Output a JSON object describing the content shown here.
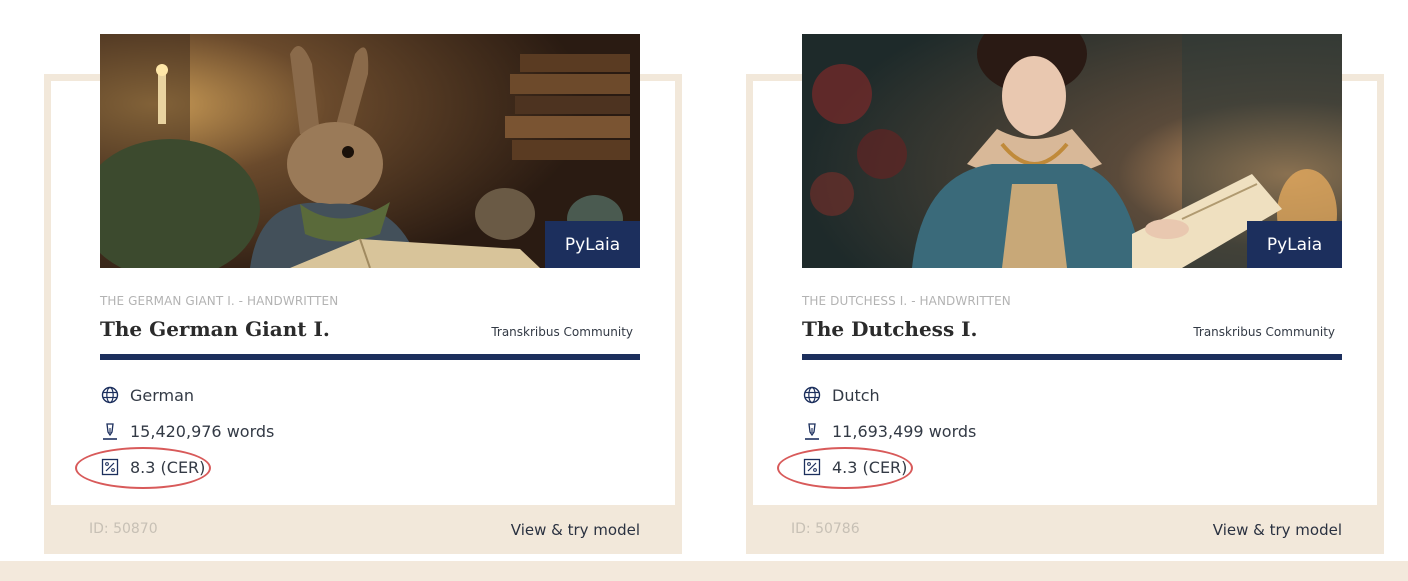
{
  "cards": [
    {
      "badge": "PyLaia",
      "subtitle": "THE GERMAN GIANT I. - HANDWRITTEN",
      "title": "The German Giant I.",
      "owner": "Transkribus Community",
      "language": "German",
      "words": "15,420,976 words",
      "cer": "8.3 (CER)",
      "id": "ID: 50870",
      "link": "View & try model",
      "image": "rabbit-reading-book-illustration"
    },
    {
      "badge": "PyLaia",
      "subtitle": "THE DUTCHESS I. - HANDWRITTEN",
      "title": "The Dutchess I.",
      "owner": "Transkribus Community",
      "language": "Dutch",
      "words": "11,693,499 words",
      "cer": "4.3 (CER)",
      "id": "ID: 50786",
      "link": "View & try model",
      "image": "lady-reading-book-illustration"
    }
  ],
  "colors": {
    "navy": "#1c2f5d",
    "beige": "#f2e8da",
    "highlight": "#d85a5a"
  },
  "icons": [
    "globe-icon",
    "pen-nib-icon",
    "percent-icon"
  ]
}
